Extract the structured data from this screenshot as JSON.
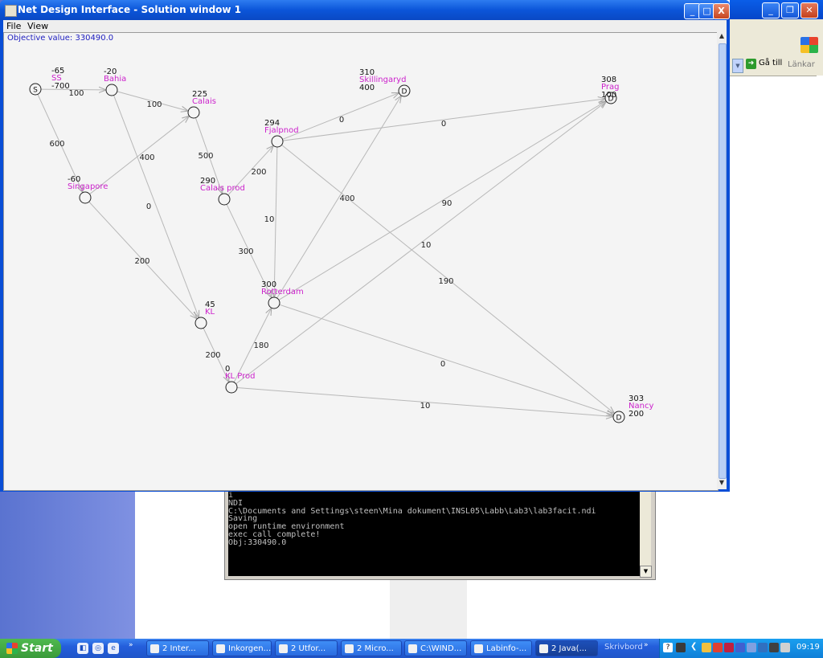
{
  "main_window": {
    "title": "Net Design Interface - Solution window 1",
    "menu": [
      "File",
      "View"
    ],
    "objective": "Objective value: 330490.0",
    "controls": {
      "minimize": "_",
      "maximize": "□",
      "close": "X"
    }
  },
  "graph": {
    "node_label_color": "#cc22cc",
    "edge_color": "#b8b8b8",
    "nodes": [
      {
        "id": "SS",
        "name": "SS",
        "top_value": "-65",
        "bottom_value": "-700",
        "mark": "S"
      },
      {
        "id": "Bahia",
        "name": "Bahia",
        "top_value": "-20",
        "bottom_value": "",
        "mark": ""
      },
      {
        "id": "Calais",
        "name": "Calais",
        "top_value": "225",
        "bottom_value": "",
        "mark": ""
      },
      {
        "id": "Skillingaryd",
        "name": "Skillingaryd",
        "top_value": "310",
        "bottom_value": "400",
        "mark": "D"
      },
      {
        "id": "Prag",
        "name": "Prag",
        "top_value": "308",
        "bottom_value": "100",
        "mark": "D"
      },
      {
        "id": "Fjalpnod",
        "name": "Fjalpnod",
        "top_value": "294",
        "bottom_value": "",
        "mark": ""
      },
      {
        "id": "Singapore",
        "name": "Singapore",
        "top_value": "-60",
        "bottom_value": "",
        "mark": ""
      },
      {
        "id": "CalaisProd",
        "name": "Calais prod",
        "top_value": "290",
        "bottom_value": "",
        "mark": ""
      },
      {
        "id": "Rotterdam",
        "name": "Rotterdam",
        "top_value": "300",
        "bottom_value": "",
        "mark": ""
      },
      {
        "id": "KL",
        "name": "KL",
        "top_value": "45",
        "bottom_value": "",
        "mark": ""
      },
      {
        "id": "KLProd",
        "name": "KL Prod",
        "top_value": "0",
        "bottom_value": "",
        "mark": ""
      },
      {
        "id": "Nancy",
        "name": "Nancy",
        "top_value": "303",
        "bottom_value": "200",
        "mark": "D"
      }
    ],
    "edges": [
      {
        "from": "SS",
        "to": "Bahia",
        "flow": "100"
      },
      {
        "from": "Bahia",
        "to": "Calais",
        "flow": "100"
      },
      {
        "from": "SS",
        "to": "Singapore",
        "flow": "600"
      },
      {
        "from": "Singapore",
        "to": "Calais",
        "flow": "400"
      },
      {
        "from": "Bahia",
        "to": "KL",
        "flow": "0"
      },
      {
        "from": "Singapore",
        "to": "KL",
        "flow": "200"
      },
      {
        "from": "Calais",
        "to": "CalaisProd",
        "flow": "500"
      },
      {
        "from": "CalaisProd",
        "to": "Fjalpnod",
        "flow": "200"
      },
      {
        "from": "CalaisProd",
        "to": "Rotterdam",
        "flow": "300"
      },
      {
        "from": "Fjalpnod",
        "to": "Skillingaryd",
        "flow": "0"
      },
      {
        "from": "Fjalpnod",
        "to": "Prag",
        "flow": "0"
      },
      {
        "from": "Fjalpnod",
        "to": "Rotterdam",
        "flow": "10"
      },
      {
        "from": "Rotterdam",
        "to": "Skillingaryd",
        "flow": "400"
      },
      {
        "from": "Rotterdam",
        "to": "Prag",
        "flow": "90"
      },
      {
        "from": "KLProd",
        "to": "Prag",
        "flow": "10"
      },
      {
        "from": "Fjalpnod",
        "to": "Nancy",
        "flow": "190"
      },
      {
        "from": "KL",
        "to": "KLProd",
        "flow": "200"
      },
      {
        "from": "KLProd",
        "to": "Rotterdam",
        "flow": "180"
      },
      {
        "from": "Rotterdam",
        "to": "Nancy",
        "flow": "0"
      },
      {
        "from": "KLProd",
        "to": "Nancy",
        "flow": "10"
      }
    ]
  },
  "console": {
    "lines": [
      "i",
      "NDI",
      "C:\\Documents and Settings\\steen\\Mina dokument\\INSL05\\Labb\\Lab3\\lab3facit.ndi",
      "Saving",
      "open runtime environment",
      "exec call complete!",
      "Obj:330490.0"
    ]
  },
  "browser": {
    "go_label": "Gå till",
    "links_label": "Länkar"
  },
  "taskbar": {
    "start_label": "Start",
    "tasks": [
      {
        "label": "2 Inter...",
        "active": false
      },
      {
        "label": "Inkorgen...",
        "active": false
      },
      {
        "label": "2 Utfor...",
        "active": false
      },
      {
        "label": "2 Micro...",
        "active": false
      },
      {
        "label": "C:\\WIND...",
        "active": false
      },
      {
        "label": "Labinfo-...",
        "active": false
      },
      {
        "label": "2 Java(...",
        "active": true
      }
    ],
    "desktop_label": "Skrivbord",
    "clock": "09:19"
  }
}
